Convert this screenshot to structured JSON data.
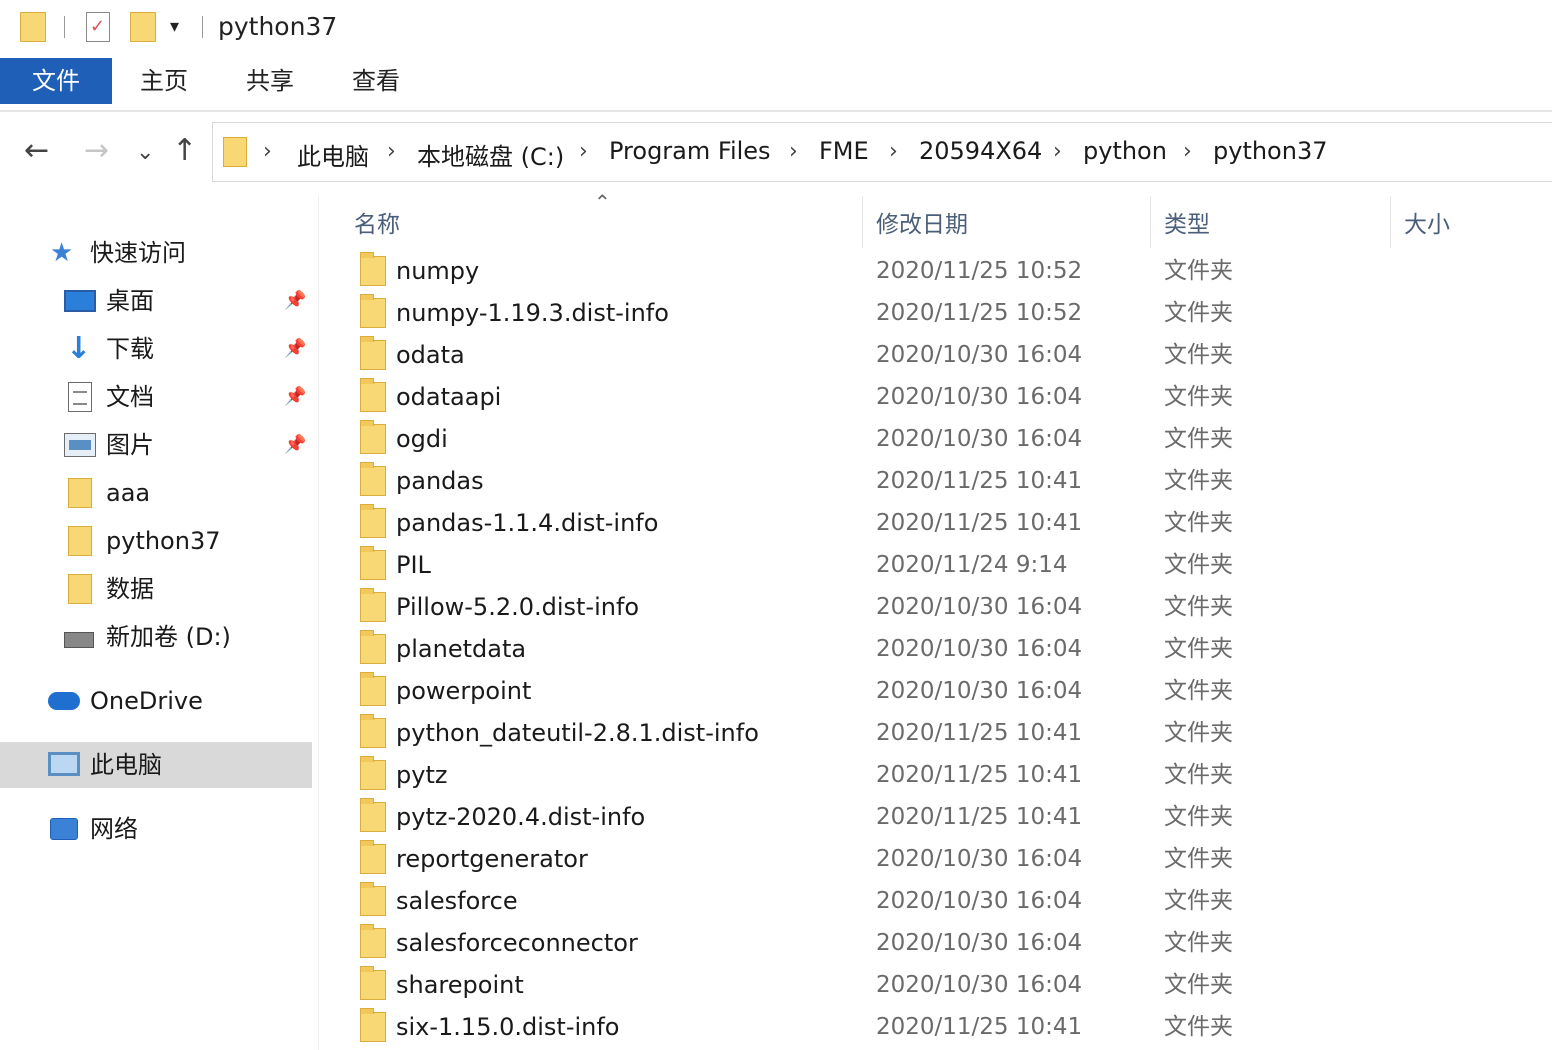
{
  "window": {
    "title": "python37"
  },
  "ribbon": {
    "tabs": [
      {
        "label": "文件",
        "active": true
      },
      {
        "label": "主页"
      },
      {
        "label": "共享"
      },
      {
        "label": "查看"
      }
    ],
    "file_color": "#1f5fb8"
  },
  "nav": {
    "back_icon": "←",
    "forward_icon": "→",
    "recent_icon": "⌄",
    "up_icon": "↑",
    "breadcrumb": [
      "此电脑",
      "本地磁盘 (C:)",
      "Program Files",
      "FME",
      "20594X64",
      "python",
      "python37"
    ],
    "separator": "›"
  },
  "sidebar": {
    "items": [
      {
        "label": "快速访问",
        "icon": "star-icon"
      },
      {
        "label": "桌面",
        "icon": "desktop-icon",
        "pinned": true
      },
      {
        "label": "下载",
        "icon": "download-icon",
        "pinned": true
      },
      {
        "label": "文档",
        "icon": "document-icon",
        "pinned": true
      },
      {
        "label": "图片",
        "icon": "picture-icon",
        "pinned": true
      },
      {
        "label": "aaa",
        "icon": "folder-icon"
      },
      {
        "label": "python37",
        "icon": "folder-icon"
      },
      {
        "label": "数据",
        "icon": "folder-icon"
      },
      {
        "label": "新加卷 (D:)",
        "icon": "drive-icon"
      },
      {
        "label": "OneDrive",
        "icon": "cloud-icon"
      },
      {
        "label": "此电脑",
        "icon": "computer-icon",
        "selected": true
      },
      {
        "label": "网络",
        "icon": "network-icon"
      }
    ]
  },
  "columns": {
    "name": "名称",
    "modified": "修改日期",
    "type": "类型",
    "size": "大小"
  },
  "files": [
    {
      "name": "numpy",
      "modified": "2020/11/25 10:52",
      "type": "文件夹"
    },
    {
      "name": "numpy-1.19.3.dist-info",
      "modified": "2020/11/25 10:52",
      "type": "文件夹"
    },
    {
      "name": "odata",
      "modified": "2020/10/30 16:04",
      "type": "文件夹"
    },
    {
      "name": "odataapi",
      "modified": "2020/10/30 16:04",
      "type": "文件夹"
    },
    {
      "name": "ogdi",
      "modified": "2020/10/30 16:04",
      "type": "文件夹"
    },
    {
      "name": "pandas",
      "modified": "2020/11/25 10:41",
      "type": "文件夹"
    },
    {
      "name": "pandas-1.1.4.dist-info",
      "modified": "2020/11/25 10:41",
      "type": "文件夹"
    },
    {
      "name": "PIL",
      "modified": "2020/11/24 9:14",
      "type": "文件夹"
    },
    {
      "name": "Pillow-5.2.0.dist-info",
      "modified": "2020/10/30 16:04",
      "type": "文件夹"
    },
    {
      "name": "planetdata",
      "modified": "2020/10/30 16:04",
      "type": "文件夹"
    },
    {
      "name": "powerpoint",
      "modified": "2020/10/30 16:04",
      "type": "文件夹"
    },
    {
      "name": "python_dateutil-2.8.1.dist-info",
      "modified": "2020/11/25 10:41",
      "type": "文件夹"
    },
    {
      "name": "pytz",
      "modified": "2020/11/25 10:41",
      "type": "文件夹"
    },
    {
      "name": "pytz-2020.4.dist-info",
      "modified": "2020/11/25 10:41",
      "type": "文件夹"
    },
    {
      "name": "reportgenerator",
      "modified": "2020/10/30 16:04",
      "type": "文件夹"
    },
    {
      "name": "salesforce",
      "modified": "2020/10/30 16:04",
      "type": "文件夹"
    },
    {
      "name": "salesforceconnector",
      "modified": "2020/10/30 16:04",
      "type": "文件夹"
    },
    {
      "name": "sharepoint",
      "modified": "2020/10/30 16:04",
      "type": "文件夹"
    },
    {
      "name": "six-1.15.0.dist-info",
      "modified": "2020/11/25 10:41",
      "type": "文件夹"
    }
  ]
}
